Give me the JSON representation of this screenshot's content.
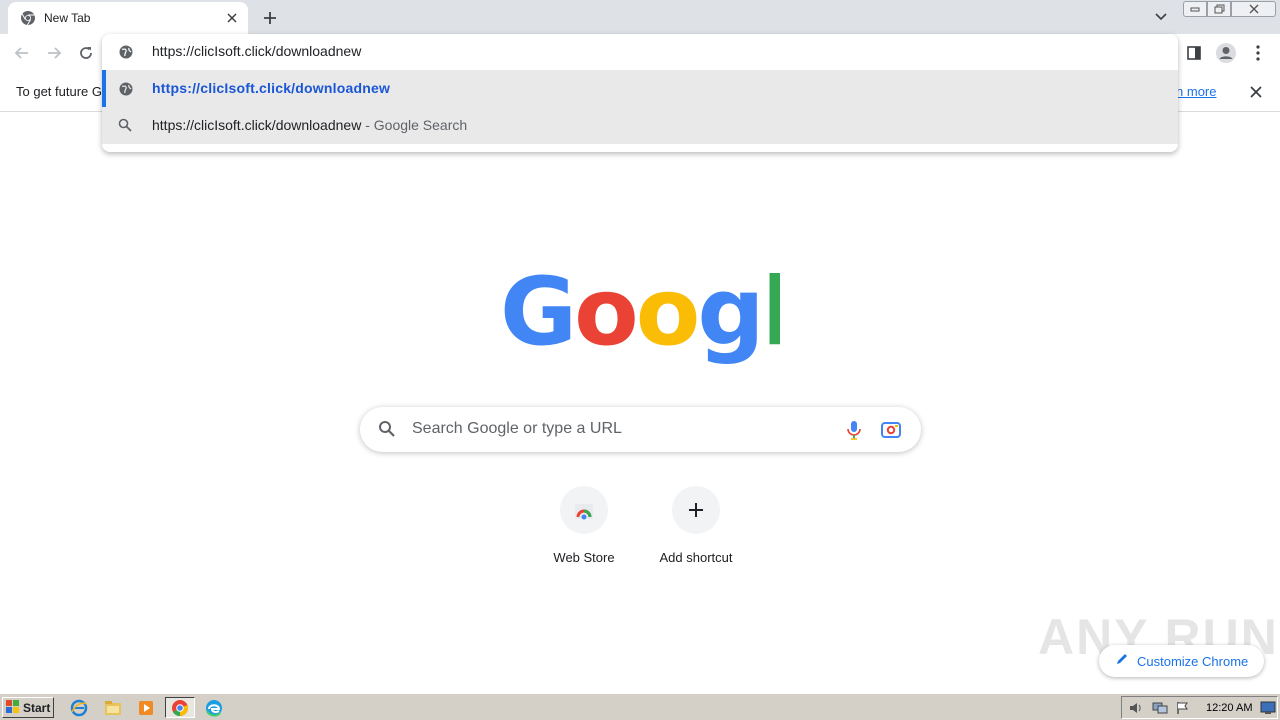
{
  "browser": {
    "tab_title": "New Tab",
    "omnibox": {
      "input_value": "https://clicIsoft.click/downloadnew",
      "suggestions": [
        {
          "text": "https://clicIsoft.click/downloadnew",
          "icon": "globe-icon"
        },
        {
          "text": "https://clicIsoft.click/downloadnew",
          "suffix": " - Google Search",
          "icon": "search-icon"
        }
      ]
    },
    "infobar": {
      "text": "To get future G",
      "link": "Learn more"
    }
  },
  "ntp": {
    "logo_text": "Google",
    "search_placeholder": "Search Google or type a URL",
    "shortcuts": [
      {
        "label": "Web Store"
      },
      {
        "label": "Add shortcut"
      }
    ],
    "customize_label": "Customize Chrome"
  },
  "watermark": "ANY RUN",
  "taskbar": {
    "start_label": "Start",
    "clock": "12:20 AM"
  },
  "colors": {
    "google_blue": "#4285f4",
    "google_red": "#ea4335",
    "google_yellow": "#fbbc05",
    "google_green": "#34a853",
    "link_blue": "#1a73e8"
  }
}
